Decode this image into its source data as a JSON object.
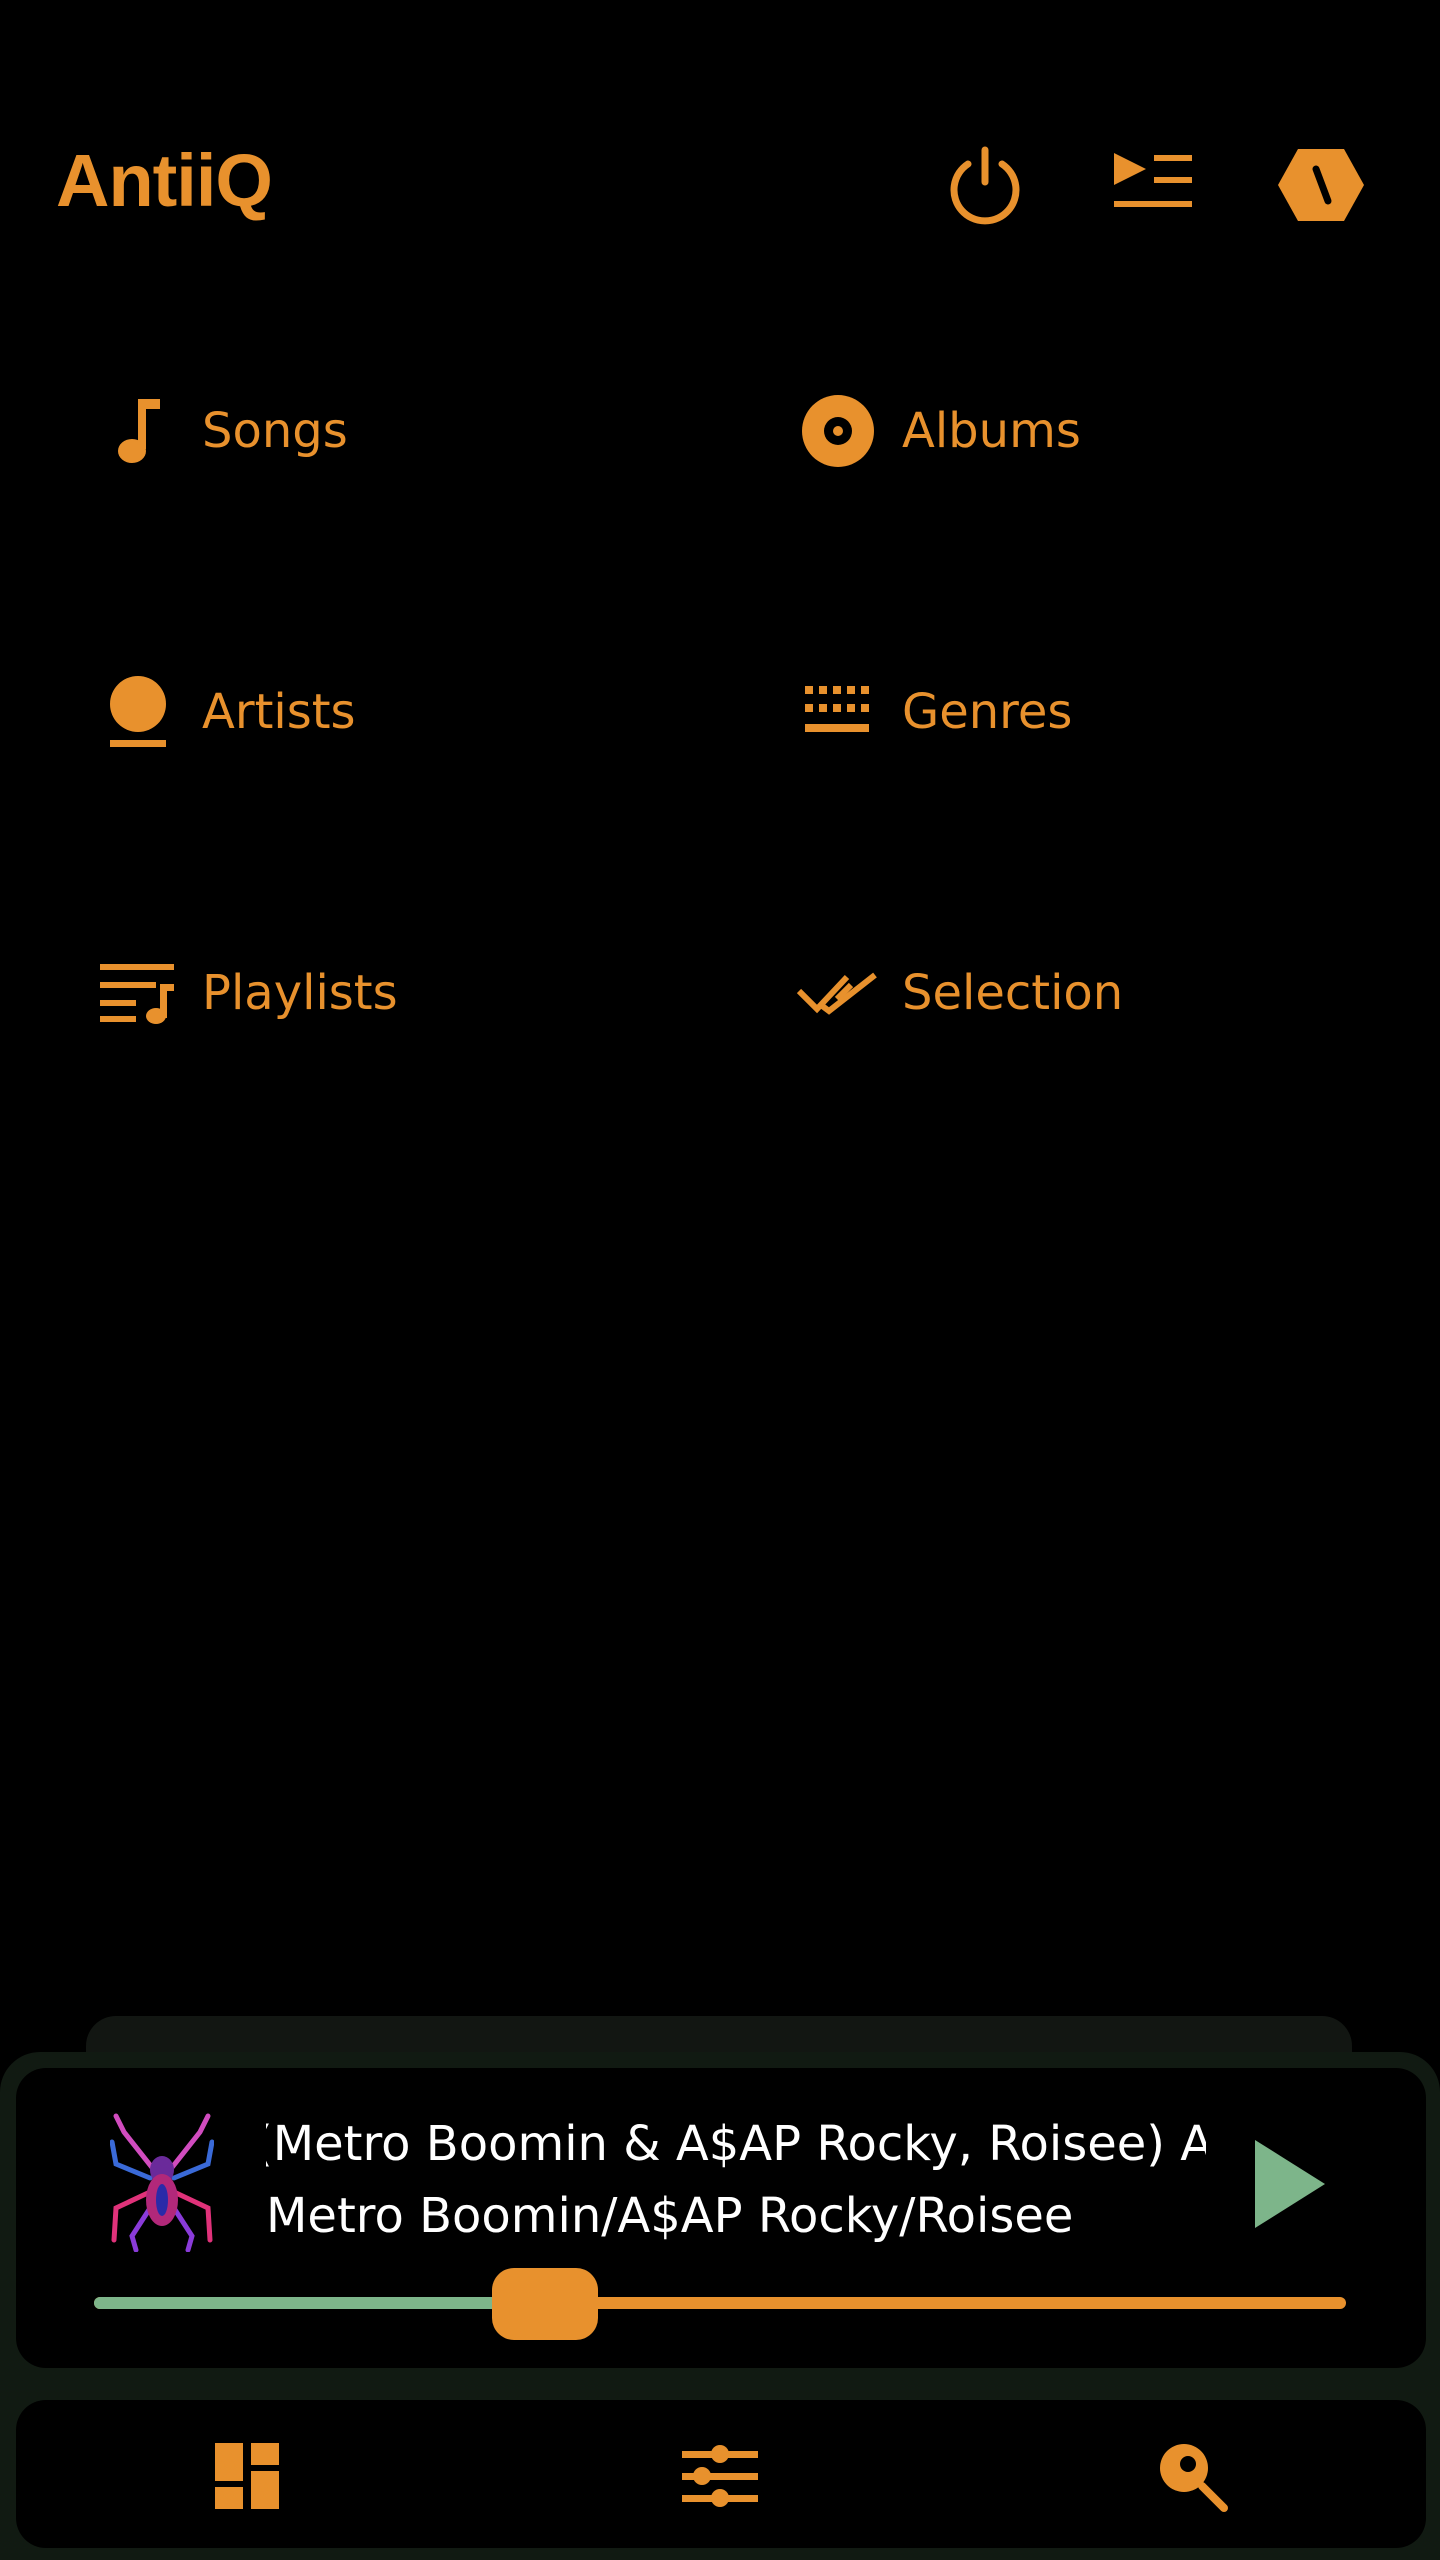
{
  "app": {
    "title": "AntiiQ",
    "accent_color": "#e8912d",
    "background_color": "#000000"
  },
  "header_icons": [
    "power-icon",
    "queue-icon",
    "settings-hex-icon"
  ],
  "library": {
    "items": [
      {
        "label": "Songs",
        "icon": "music-note-icon"
      },
      {
        "label": "Albums",
        "icon": "album-disc-icon"
      },
      {
        "label": "Artists",
        "icon": "artist-person-icon"
      },
      {
        "label": "Genres",
        "icon": "genres-grid-icon"
      },
      {
        "label": "Playlists",
        "icon": "playlist-icon"
      },
      {
        "label": "Selection",
        "icon": "double-check-icon"
      }
    ]
  },
  "player": {
    "title": "(Metro Boomin & A$AP Rocky, Roisee) Am",
    "artist": "Metro Boomin/A$AP Rocky/Roisee",
    "progress_fraction": 0.36,
    "progress_color": "#7db58a",
    "play_icon": "play-icon"
  },
  "bottom_nav": {
    "items": [
      "dashboard-icon",
      "equalizer-icon",
      "search-icon"
    ]
  }
}
